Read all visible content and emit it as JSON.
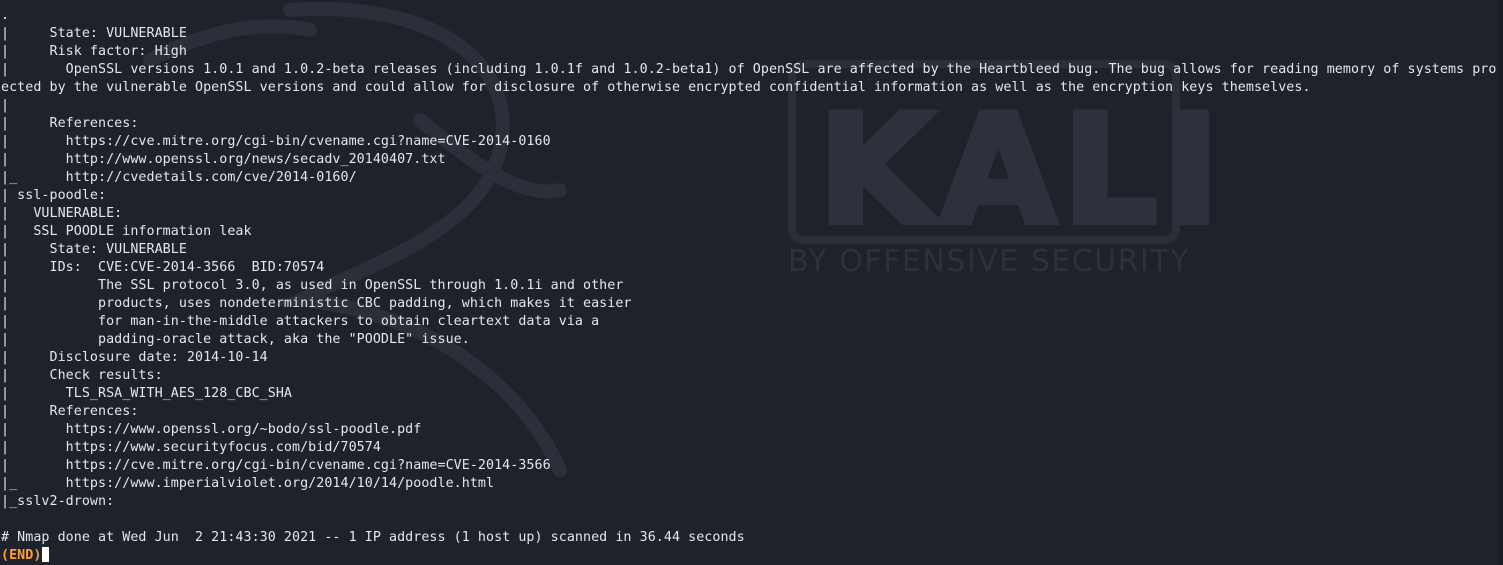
{
  "terminal": {
    "lines": [
      ".",
      "|     State: VULNERABLE",
      "|     Risk factor: High",
      "|       OpenSSL versions 1.0.1 and 1.0.2-beta releases (including 1.0.1f and 1.0.2-beta1) of OpenSSL are affected by the Heartbleed bug. The bug allows for reading memory of systems prot",
      "ected by the vulnerable OpenSSL versions and could allow for disclosure of otherwise encrypted confidential information as well as the encryption keys themselves.",
      "|",
      "|     References:",
      "|       https://cve.mitre.org/cgi-bin/cvename.cgi?name=CVE-2014-0160",
      "|       http://www.openssl.org/news/secadv_20140407.txt",
      "|_      http://cvedetails.com/cve/2014-0160/",
      "| ssl-poodle:",
      "|   VULNERABLE:",
      "|   SSL POODLE information leak",
      "|     State: VULNERABLE",
      "|     IDs:  CVE:CVE-2014-3566  BID:70574",
      "|           The SSL protocol 3.0, as used in OpenSSL through 1.0.1i and other",
      "|           products, uses nondeterministic CBC padding, which makes it easier",
      "|           for man-in-the-middle attackers to obtain cleartext data via a",
      "|           padding-oracle attack, aka the \"POODLE\" issue.",
      "|     Disclosure date: 2014-10-14",
      "|     Check results:",
      "|       TLS_RSA_WITH_AES_128_CBC_SHA",
      "|     References:",
      "|       https://www.openssl.org/~bodo/ssl-poodle.pdf",
      "|       https://www.securityfocus.com/bid/70574",
      "|       https://cve.mitre.org/cgi-bin/cvename.cgi?name=CVE-2014-3566",
      "|_      https://www.imperialviolet.org/2014/10/14/poodle.html",
      "|_sslv2-drown:",
      "",
      "# Nmap done at Wed Jun  2 21:43:30 2021 -- 1 IP address (1 host up) scanned in 36.44 seconds"
    ],
    "prompt": "(END)"
  },
  "watermark": {
    "brand": "KALI",
    "tagline": "BY OFFENSIVE SECURITY",
    "icon": "kali-dragon-icon"
  },
  "colors": {
    "background": "#1e222b",
    "text": "#e4e6ea",
    "prompt": "#ff9d3b",
    "watermark": "#2c313b"
  }
}
